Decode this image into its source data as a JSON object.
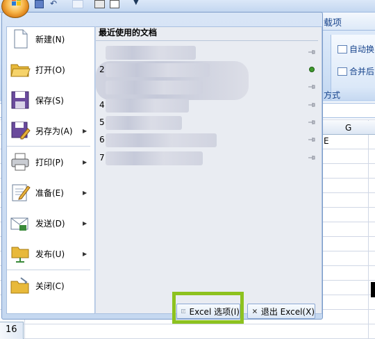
{
  "ribbon": {
    "tab_partial": "载项",
    "commands": [
      "自动换",
      "合并后"
    ],
    "group_partial": "方式"
  },
  "sheet": {
    "column_header": "G",
    "cell_text": "E",
    "row_number": "16"
  },
  "office_menu": {
    "items": [
      {
        "label": "新建(N)",
        "has_submenu": false,
        "icon": "new-document-icon"
      },
      {
        "label": "打开(O)",
        "has_submenu": false,
        "icon": "open-folder-icon"
      },
      {
        "label": "保存(S)",
        "has_submenu": false,
        "icon": "save-icon"
      },
      {
        "label": "另存为(A)",
        "has_submenu": true,
        "icon": "save-as-icon"
      },
      {
        "label": "打印(P)",
        "has_submenu": true,
        "icon": "printer-icon"
      },
      {
        "label": "准备(E)",
        "has_submenu": true,
        "icon": "prepare-icon"
      },
      {
        "label": "发送(D)",
        "has_submenu": true,
        "icon": "send-icon"
      },
      {
        "label": "发布(U)",
        "has_submenu": true,
        "icon": "publish-icon"
      },
      {
        "label": "关闭(C)",
        "has_submenu": false,
        "icon": "close-folder-icon"
      }
    ],
    "recent_title": "最近使用的文档",
    "recent_items": [
      {
        "index": "",
        "pinned": false
      },
      {
        "index": "2",
        "pinned": true
      },
      {
        "index": "",
        "pinned": false
      },
      {
        "index": "4",
        "pinned": false
      },
      {
        "index": "5",
        "pinned": false
      },
      {
        "index": "6",
        "pinned": false
      },
      {
        "index": "7",
        "pinned": false
      }
    ],
    "options_button": "Excel 选项(I)",
    "exit_button": "退出 Excel(X)"
  },
  "colors": {
    "highlight": "#8dc21f",
    "menu_background": "#c5d8f0",
    "recent_pane": "#e9ecf2"
  }
}
